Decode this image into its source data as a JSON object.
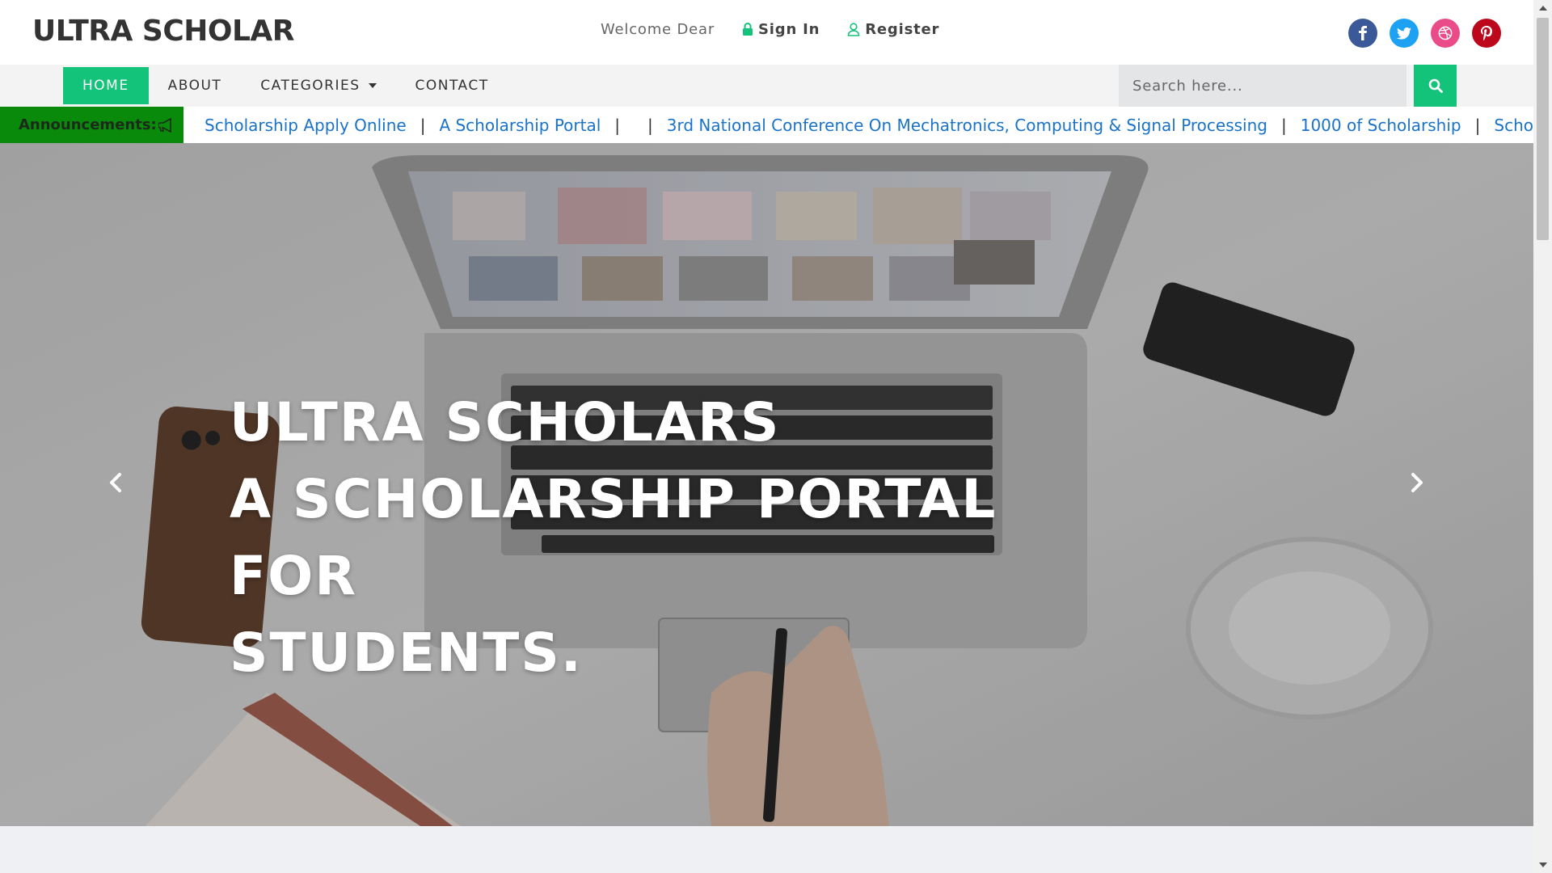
{
  "header": {
    "logo": "ULTRA SCHOLAR",
    "welcome": "Welcome Dear",
    "sign_in": "Sign In",
    "register": "Register",
    "socials": [
      "facebook-icon",
      "twitter-icon",
      "dribbble-icon",
      "pinterest-icon"
    ]
  },
  "nav": {
    "items": [
      {
        "label": "HOME",
        "active": true
      },
      {
        "label": "ABOUT"
      },
      {
        "label": "CATEGORIES",
        "dropdown": true
      },
      {
        "label": "CONTACT"
      }
    ],
    "search_placeholder": "Search here..."
  },
  "announcements": {
    "label": "Announcements:",
    "items": [
      "Scholarship Apply Online",
      "A Scholarship Portal",
      "",
      "3rd National Conference On Mechatronics, Computing & Signal Processing",
      "1000 of Scholarship",
      "Scholarship"
    ]
  },
  "hero": {
    "line1": "ULTRA SCHOLARS",
    "line2": "A SCHOLARSHIP PORTAL FOR",
    "line3": "STUDENTS."
  },
  "colors": {
    "accent": "#14c37a",
    "announce_label_bg": "#0a8a0a",
    "link": "#1a73c9"
  }
}
